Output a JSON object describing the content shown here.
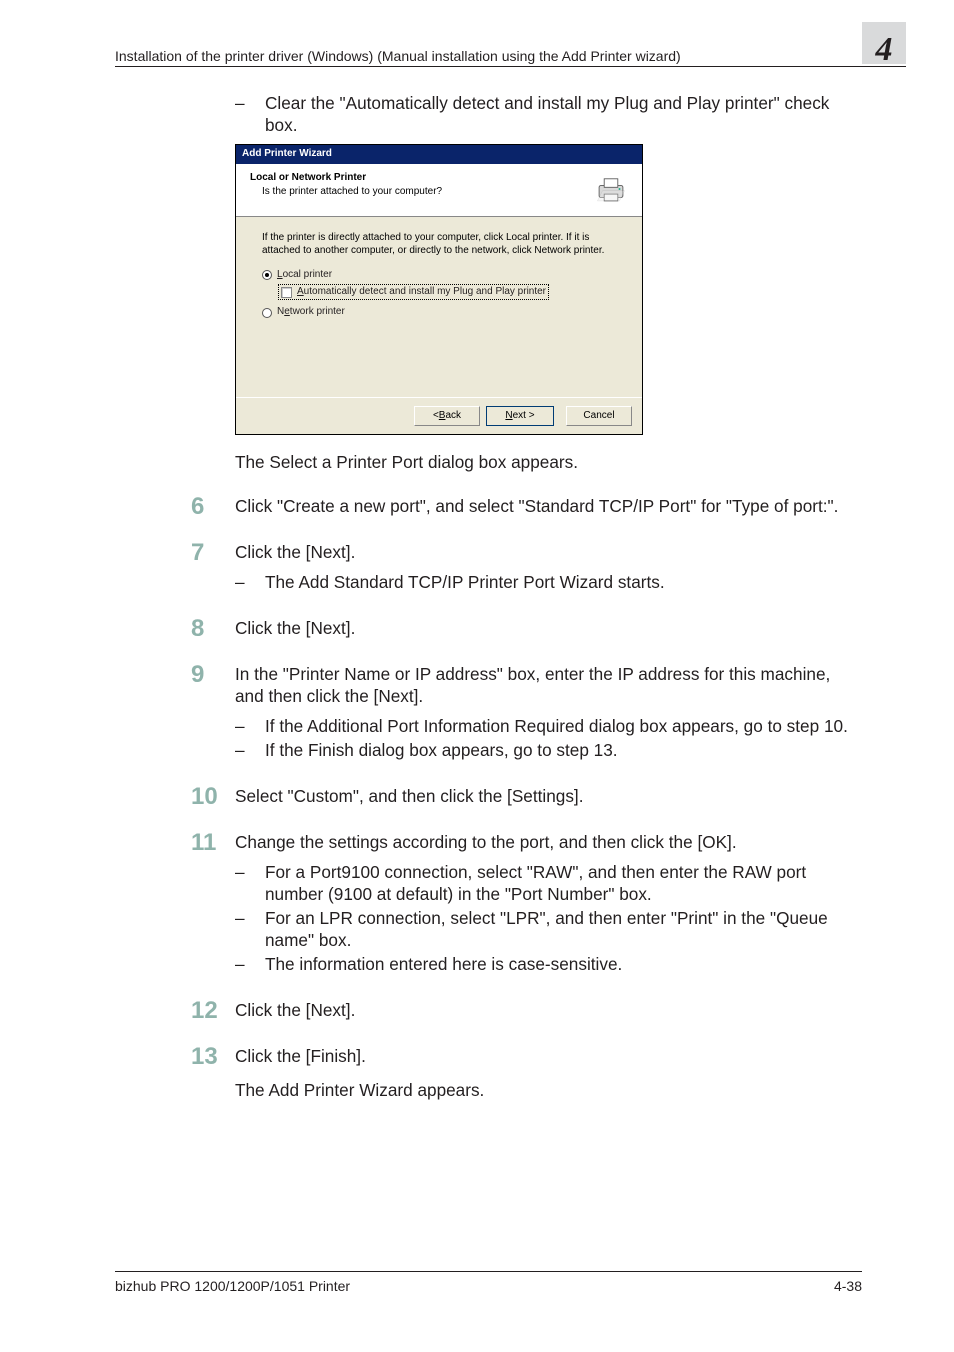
{
  "header": {
    "breadcrumb": "Installation of the printer driver (Windows) (Manual installation using the Add Printer wizard)",
    "chapter_number": "4"
  },
  "intro_bullet": "Clear the \"Automatically detect and install my Plug and Play printer\" check box.",
  "wizard": {
    "title": "Add Printer Wizard",
    "heading": "Local or Network Printer",
    "subheading": "Is the printer attached to your computer?",
    "hint": "If the printer is directly attached to your computer, click Local printer. If it is attached to another computer, or directly to the network, click Network printer.",
    "radio_local_prefix": "L",
    "radio_local_rest": "ocal printer",
    "checkbox_prefix": "A",
    "checkbox_rest": "utomatically detect and install my Plug and Play printer",
    "radio_network_prefix": "e",
    "radio_network_before": "N",
    "radio_network_rest": "twork printer",
    "btn_back_prefix": "< ",
    "btn_back_ul": "B",
    "btn_back_rest": "ack",
    "btn_next_ul": "N",
    "btn_next_rest": "ext >",
    "btn_cancel": "Cancel"
  },
  "after_wizard": "The Select a Printer Port dialog box appears.",
  "steps": [
    {
      "num": "6",
      "text": "Click \"Create a new port\", and select \"Standard TCP/IP Port\" for \"Type of port:\".",
      "subs": []
    },
    {
      "num": "7",
      "text": "Click the [Next].",
      "subs": [
        "The Add Standard TCP/IP Printer Port Wizard starts."
      ]
    },
    {
      "num": "8",
      "text": "Click the [Next].",
      "subs": []
    },
    {
      "num": "9",
      "text": "In the \"Printer Name or IP address\" box, enter the IP address for this machine, and then click the [Next].",
      "subs": [
        "If the Additional Port Information Required dialog box appears, go to step 10.",
        "If the Finish dialog box appears, go to step 13."
      ]
    },
    {
      "num": "10",
      "text": "Select \"Custom\", and then click the [Settings].",
      "subs": []
    },
    {
      "num": "11",
      "text": "Change the settings according to the port, and then click the [OK].",
      "subs": [
        "For a Port9100 connection, select \"RAW\", and then enter the RAW port number (9100 at default) in the \"Port Number\" box.",
        "For an LPR connection, select \"LPR\", and then enter \"Print\" in the \"Queue name\" box.",
        "The information entered here is case-sensitive."
      ]
    },
    {
      "num": "12",
      "text": "Click the [Next].",
      "subs": []
    },
    {
      "num": "13",
      "text": "Click the [Finish].",
      "subs": [],
      "after": "The Add Printer Wizard appears."
    }
  ],
  "footer": {
    "left": "bizhub PRO 1200/1200P/1051 Printer",
    "right": "4-38"
  }
}
